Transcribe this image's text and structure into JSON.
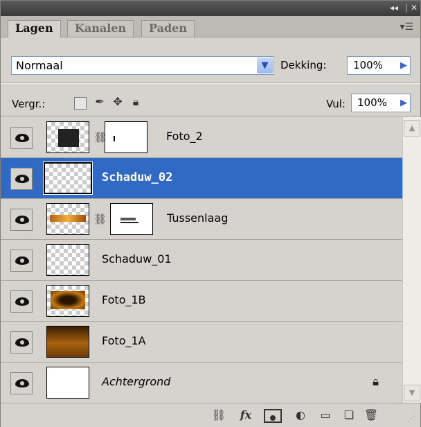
{
  "window": {
    "collapse_label": "◂◂",
    "close_label": "✕"
  },
  "tabs": [
    {
      "label": "Lagen"
    },
    {
      "label": "Kanalen"
    },
    {
      "label": "Paden"
    }
  ],
  "blend": {
    "mode": "Normaal",
    "opacity_label": "Dekking:",
    "opacity_value": "100%"
  },
  "lock": {
    "label": "Vergr.:",
    "fill_label": "Vul:",
    "fill_value": "100%"
  },
  "layers": [
    {
      "name": "Foto_2",
      "visible": true,
      "selected": false,
      "has_mask": true
    },
    {
      "name": "Schaduw_02",
      "visible": true,
      "selected": true,
      "has_mask": false
    },
    {
      "name": "Tussenlaag",
      "visible": true,
      "selected": false,
      "has_mask": true
    },
    {
      "name": "Schaduw_01",
      "visible": true,
      "selected": false,
      "has_mask": false
    },
    {
      "name": "Foto_1B",
      "visible": true,
      "selected": false,
      "has_mask": false
    },
    {
      "name": "Foto_1A",
      "visible": true,
      "selected": false,
      "has_mask": false
    },
    {
      "name": "Achtergrond",
      "visible": true,
      "selected": false,
      "has_mask": false,
      "locked": true
    }
  ],
  "bottom_toolbar": {
    "icons": [
      "link-layers-icon",
      "fx-icon",
      "add-mask-icon",
      "adjustment-layer-icon",
      "new-group-icon",
      "new-layer-icon",
      "delete-layer-icon"
    ],
    "fx_label": "fx"
  },
  "colors": {
    "selection": "#316ac5",
    "panel": "#d6d3ce",
    "accent_arrow": "#3a64c6"
  }
}
